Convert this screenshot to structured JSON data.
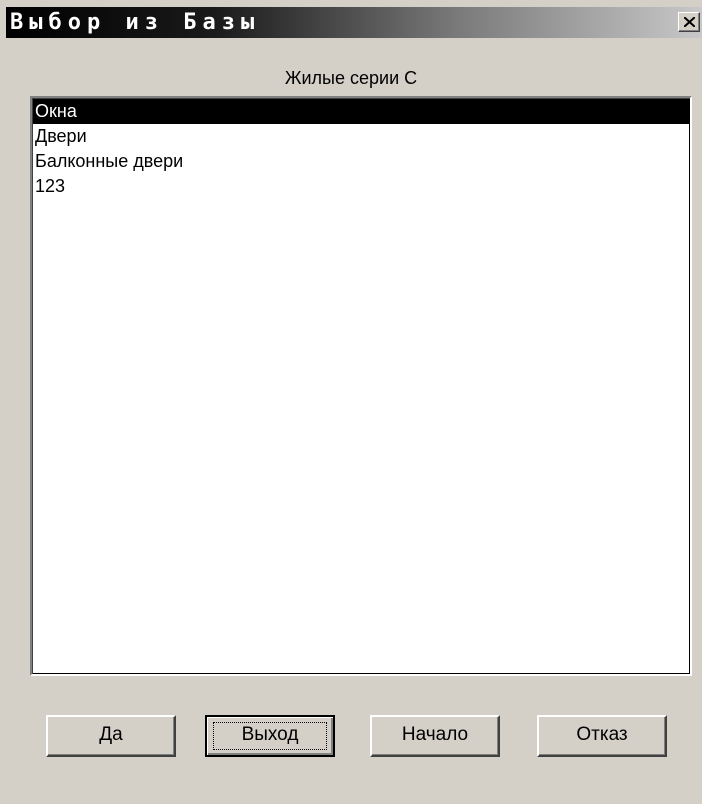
{
  "window": {
    "title": "Выбор из Базы"
  },
  "series_label": "Жилые серии С",
  "list": {
    "items": [
      {
        "label": "Окна",
        "selected": true
      },
      {
        "label": "Двери",
        "selected": false
      },
      {
        "label": "Балконные двери",
        "selected": false
      },
      {
        "label": "123",
        "selected": false
      }
    ]
  },
  "buttons": {
    "yes_label": "Да",
    "exit_label": "Выход",
    "start_label": "Начало",
    "cancel_label": "Отказ"
  },
  "icons": {
    "close": "close-icon"
  },
  "colors": {
    "face": "#d4d0c8",
    "selection": "#000000"
  }
}
